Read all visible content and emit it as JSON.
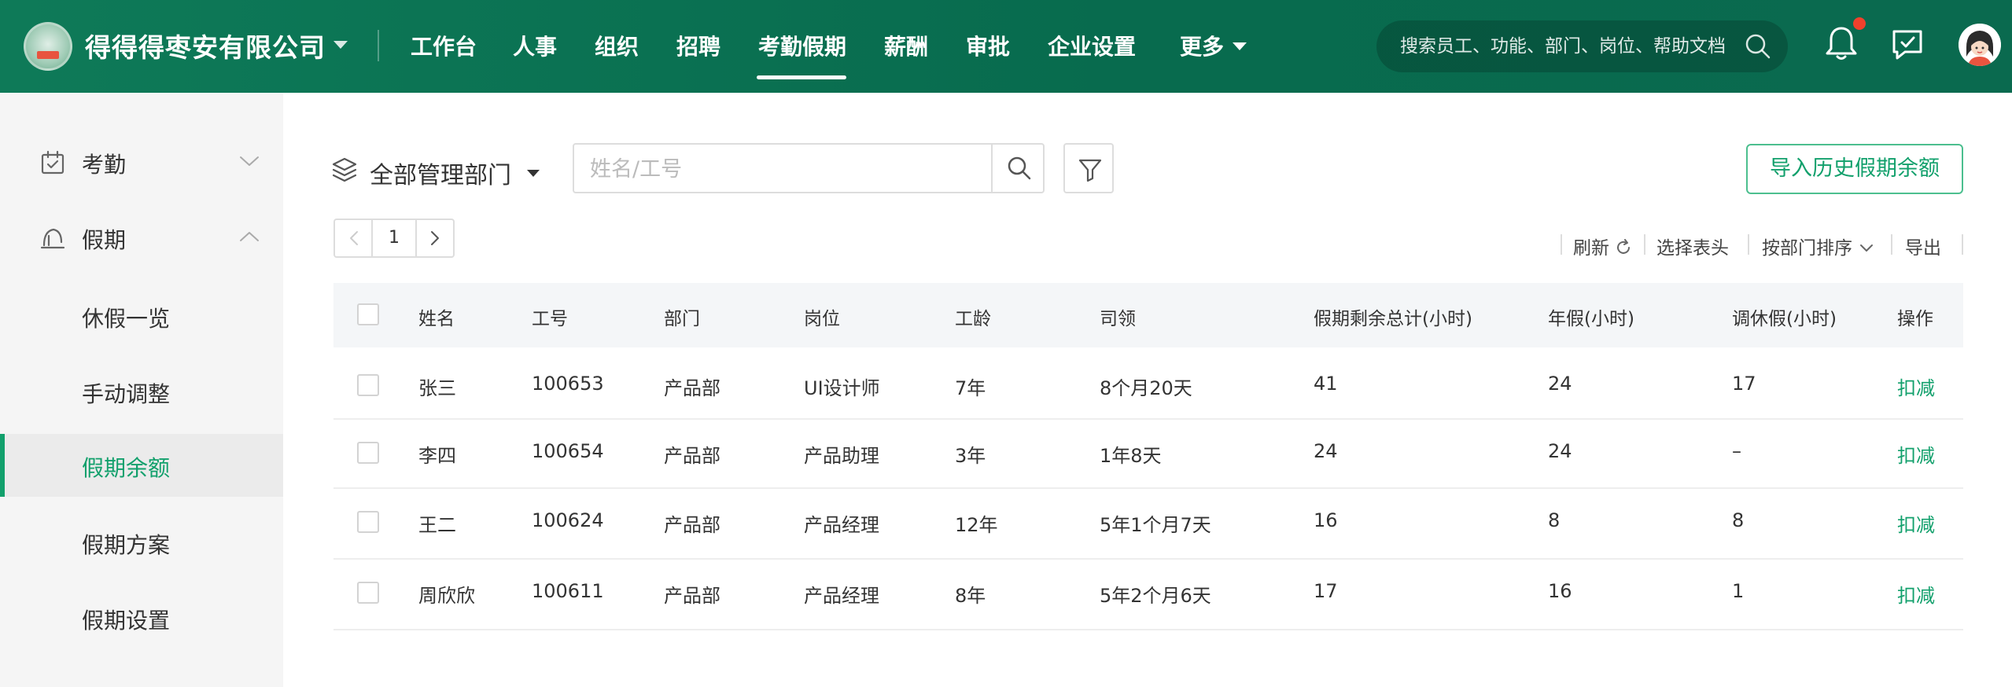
{
  "header": {
    "company": "得得得枣安有限公司",
    "nav": [
      "工作台",
      "人事",
      "组织",
      "招聘",
      "考勤假期",
      "薪酬",
      "审批",
      "企业设置",
      "更多"
    ],
    "active_nav": "考勤假期",
    "search_placeholder": "搜索员工、功能、部门、岗位、帮助文档",
    "icons": [
      "logo",
      "search-icon",
      "bell-icon",
      "message-icon",
      "avatar"
    ],
    "accent": "#0e7a58"
  },
  "sidebar": {
    "groups": [
      {
        "label": "考勤",
        "icon": "calendar-check-icon",
        "expanded": false
      },
      {
        "label": "假期",
        "icon": "umbrella-icon",
        "expanded": true
      }
    ],
    "items": [
      "休假一览",
      "手动调整",
      "假期余额",
      "假期方案",
      "假期设置"
    ],
    "active_item": "假期余额",
    "active_color": "#12a06c"
  },
  "toolbar": {
    "dept_label": "全部管理部门",
    "search_placeholder": "姓名/工号",
    "import_label": "导入历史假期余额",
    "page": "1",
    "actions": [
      "刷新",
      "选择表头",
      "按部门排序",
      "导出"
    ]
  },
  "table": {
    "columns": [
      "姓名",
      "工号",
      "部门",
      "岗位",
      "工龄",
      "司领",
      "假期剩余总计(小时)",
      "年假(小时)",
      "调休假(小时)",
      "操作"
    ],
    "rows": [
      [
        "张三",
        "100653",
        "产品部",
        "UI设计师",
        "7年",
        "8个月20天",
        "41",
        "24",
        "17",
        "扣减"
      ],
      [
        "李四",
        "100654",
        "产品部",
        "产品助理",
        "3年",
        "1年8天",
        "24",
        "24",
        "–",
        "扣减"
      ],
      [
        "王二",
        "100624",
        "产品部",
        "产品经理",
        "12年",
        "5年1个月7天",
        "16",
        "8",
        "8",
        "扣减"
      ],
      [
        "周欣欣",
        "100611",
        "产品部",
        "产品经理",
        "8年",
        "5年2个月6天",
        "17",
        "16",
        "1",
        "扣减"
      ]
    ]
  }
}
